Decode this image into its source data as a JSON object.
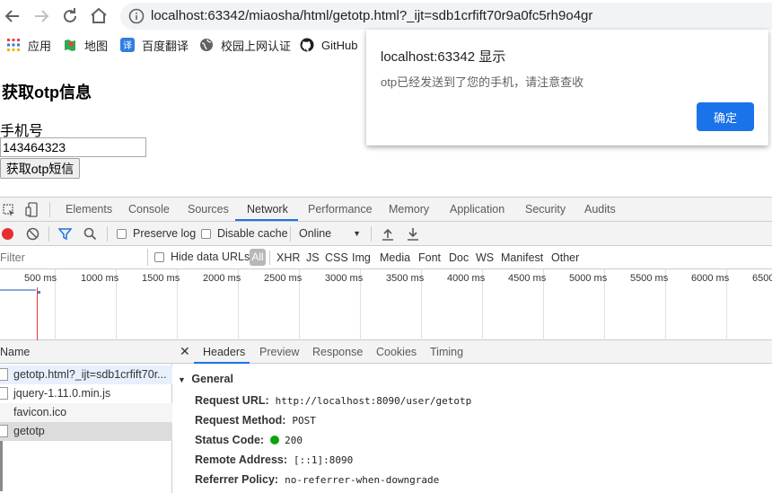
{
  "browser": {
    "url": "localhost:63342/miaosha/html/getotp.html?_ijt=sdb1crfift70r9a0fc5rh9o4gr",
    "bookmarks": [
      {
        "label": "应用",
        "icon": "apps-grid-icon"
      },
      {
        "label": "地图",
        "icon": "map-icon"
      },
      {
        "label": "百度翻译",
        "icon": "translate-icon"
      },
      {
        "label": "校园上网认证",
        "icon": "globe-icon"
      },
      {
        "label": "GitHub",
        "icon": "github-icon"
      }
    ]
  },
  "page": {
    "heading": "获取otp信息",
    "phone_label": "手机号",
    "phone_value": "143464323",
    "otp_button": "获取otp短信"
  },
  "dialog": {
    "title": "localhost:63342 显示",
    "message": "otp已经发送到了您的手机，请注意查收",
    "ok_label": "确定",
    "accent_color": "#1a73e8"
  },
  "devtools": {
    "tabs": [
      "Elements",
      "Console",
      "Sources",
      "Network",
      "Performance",
      "Memory",
      "Application",
      "Security",
      "Audits"
    ],
    "active_tab": "Network",
    "toolbar": {
      "preserve_log": "Preserve log",
      "disable_cache": "Disable cache",
      "throttle": "Online"
    },
    "filter": {
      "placeholder": "Filter",
      "hide_data_urls": "Hide data URLs",
      "types": [
        "All",
        "XHR",
        "JS",
        "CSS",
        "Img",
        "Media",
        "Font",
        "Doc",
        "WS",
        "Manifest",
        "Other"
      ]
    },
    "timeline_ticks": [
      "500 ms",
      "1000 ms",
      "1500 ms",
      "2000 ms",
      "2500 ms",
      "3000 ms",
      "3500 ms",
      "4000 ms",
      "4500 ms",
      "5000 ms",
      "5500 ms",
      "6000 ms",
      "6500"
    ],
    "name_header": "Name",
    "requests": [
      "getotp.html?_ijt=sdb1crfift70r...",
      "jquery-1.11.0.min.js",
      "favicon.ico",
      "getotp"
    ],
    "detail_tabs": [
      "Headers",
      "Preview",
      "Response",
      "Cookies",
      "Timing"
    ],
    "general": {
      "title": "General",
      "rows": [
        {
          "key": "Request URL:",
          "value": "http://localhost:8090/user/getotp"
        },
        {
          "key": "Request Method:",
          "value": "POST"
        },
        {
          "key": "Status Code:",
          "value": "200",
          "status_color": "#0ca30c"
        },
        {
          "key": "Remote Address:",
          "value": "[::1]:8090"
        },
        {
          "key": "Referrer Policy:",
          "value": "no-referrer-when-downgrade"
        }
      ]
    }
  }
}
